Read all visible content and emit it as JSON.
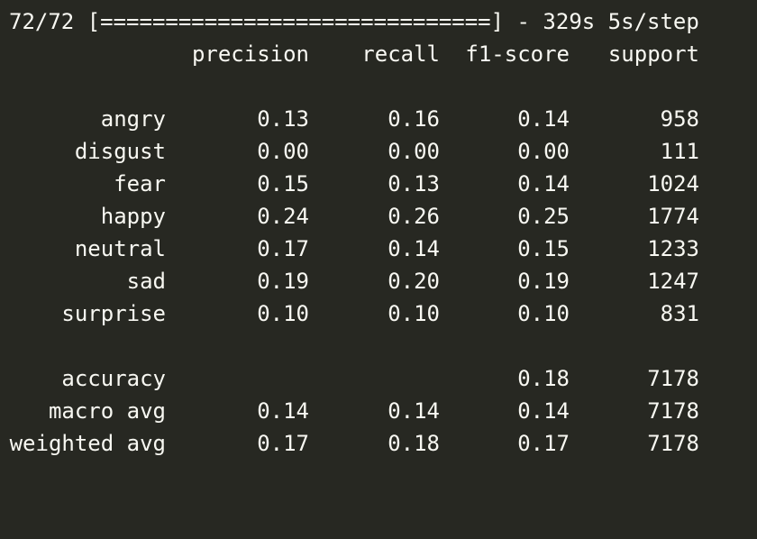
{
  "progress": {
    "text": "72/72 [==============================] - 329s 5s/step"
  },
  "report": {
    "headers": [
      "precision",
      "recall",
      "f1-score",
      "support"
    ],
    "classes": [
      {
        "label": "angry",
        "precision": "0.13",
        "recall": "0.16",
        "f1": "0.14",
        "support": "958"
      },
      {
        "label": "disgust",
        "precision": "0.00",
        "recall": "0.00",
        "f1": "0.00",
        "support": "111"
      },
      {
        "label": "fear",
        "precision": "0.15",
        "recall": "0.13",
        "f1": "0.14",
        "support": "1024"
      },
      {
        "label": "happy",
        "precision": "0.24",
        "recall": "0.26",
        "f1": "0.25",
        "support": "1774"
      },
      {
        "label": "neutral",
        "precision": "0.17",
        "recall": "0.14",
        "f1": "0.15",
        "support": "1233"
      },
      {
        "label": "sad",
        "precision": "0.19",
        "recall": "0.20",
        "f1": "0.19",
        "support": "1247"
      },
      {
        "label": "surprise",
        "precision": "0.10",
        "recall": "0.10",
        "f1": "0.10",
        "support": "831"
      }
    ],
    "summary": [
      {
        "label": "accuracy",
        "precision": "",
        "recall": "",
        "f1": "0.18",
        "support": "7178"
      },
      {
        "label": "macro avg",
        "precision": "0.14",
        "recall": "0.14",
        "f1": "0.14",
        "support": "7178"
      },
      {
        "label": "weighted avg",
        "precision": "0.17",
        "recall": "0.18",
        "f1": "0.17",
        "support": "7178"
      }
    ]
  },
  "colors": {
    "background": "#272822",
    "text": "#f8f8f2"
  }
}
